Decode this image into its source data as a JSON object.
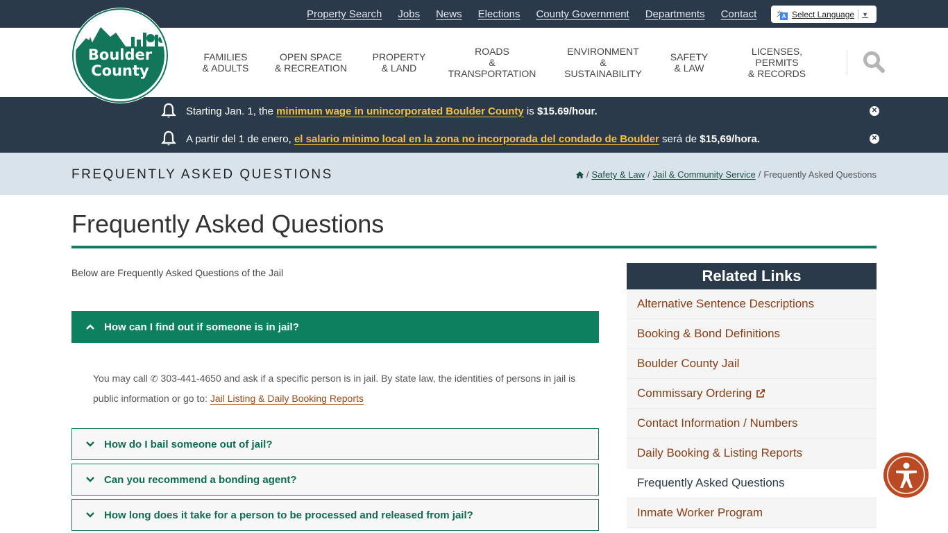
{
  "utility": {
    "links": [
      "Property Search",
      "Jobs",
      "News",
      "Elections",
      "County Government",
      "Departments",
      "Contact"
    ],
    "language_select": "Select Language",
    "language_arrow": "▼"
  },
  "header": {
    "logo_line1": "Boulder",
    "logo_line2": "County",
    "nav": [
      "Families\n& Adults",
      "Open Space\n& Recreation",
      "Property\n& Land",
      "Roads\n& Transportation",
      "Environment\n& Sustainability",
      "Safety\n& Law",
      "Licenses, Permits\n& Records"
    ]
  },
  "alerts": [
    {
      "prefix": "Starting Jan. 1, the ",
      "link": "minimum wage in unincorporated Boulder County",
      "middle": " is ",
      "bold": "$15.69/hour."
    },
    {
      "prefix": "A partir del 1 de enero, ",
      "link": "el salario mínimo local en la zona no incorporada del condado de Boulder",
      "middle": " será de ",
      "bold": "$15,69/hora."
    }
  ],
  "title_bar": {
    "heading": "Frequently Asked Questions",
    "breadcrumb": {
      "home_icon": "home-icon",
      "items": [
        "Safety & Law",
        "Jail & Community Service"
      ],
      "current": "Frequently Asked Questions",
      "separator": "/"
    }
  },
  "main": {
    "title": "Frequently Asked Questions",
    "intro": "Below are Frequently Asked Questions of the Jail",
    "faqs": [
      {
        "question": "How can I find out if someone is in jail?",
        "expanded": true,
        "answer_part1": "You may call",
        "phone": "303-441-4650",
        "answer_part2": " and ask if a specific person is in jail. By state law, the identities of persons in jail is public information or go to: ",
        "answer_link": "Jail Listing & Daily Booking Reports"
      },
      {
        "question": "How do I bail someone out of jail?",
        "expanded": false
      },
      {
        "question": "Can you recommend a bonding agent?",
        "expanded": false
      },
      {
        "question": "How long does it take for a person to be processed and released from jail?",
        "expanded": false
      }
    ]
  },
  "sidebar": {
    "heading": "Related Links",
    "items": [
      {
        "label": "Alternative Sentence Descriptions",
        "active": false,
        "external": false
      },
      {
        "label": "Booking & Bond Definitions",
        "active": false,
        "external": false
      },
      {
        "label": "Boulder County Jail",
        "active": false,
        "external": false
      },
      {
        "label": "Commissary Ordering",
        "active": false,
        "external": true
      },
      {
        "label": "Contact Information / Numbers",
        "active": false,
        "external": false
      },
      {
        "label": "Daily Booking & Listing Reports",
        "active": false,
        "external": false
      },
      {
        "label": "Frequently Asked Questions",
        "active": true,
        "external": false
      },
      {
        "label": "Inmate Worker Program",
        "active": false,
        "external": false
      }
    ]
  },
  "colors": {
    "navy": "#2b3a4a",
    "green": "#0d8060",
    "highlight": "#f5c33b",
    "link_brown": "#8b3d13",
    "accessibility": "#b94a23"
  }
}
